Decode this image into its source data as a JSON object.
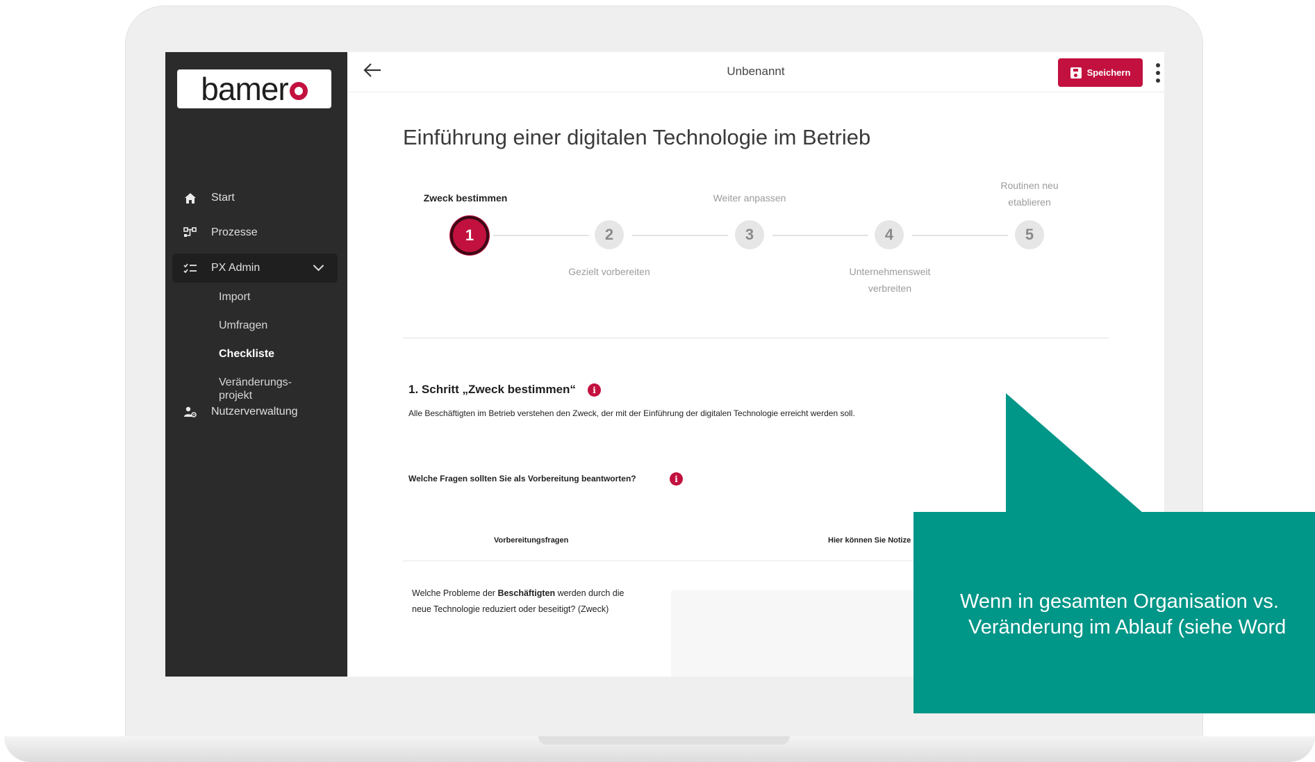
{
  "app": {
    "logo_text": "bamer",
    "document_title": "Unbenannt",
    "save_label": "Speichern"
  },
  "sidebar": {
    "items": [
      {
        "label": "Start",
        "icon": "home-icon"
      },
      {
        "label": "Prozesse",
        "icon": "process-icon"
      },
      {
        "label": "PX Admin",
        "icon": "checklist-icon",
        "expanded": true
      },
      {
        "label": "Nutzerverwaltung",
        "icon": "user-settings-icon"
      }
    ],
    "sub_items": [
      {
        "label": "Import"
      },
      {
        "label": "Umfragen"
      },
      {
        "label": "Checkliste",
        "current": true
      },
      {
        "label": "Veränderungs-",
        "label2": "projekt"
      }
    ]
  },
  "main": {
    "title": "Einführung einer digitalen Technologie im Betrieb",
    "steps": [
      {
        "number": "1",
        "label": "Zweck bestimmen",
        "state": "current"
      },
      {
        "number": "2",
        "label": "Gezielt vorbereiten"
      },
      {
        "number": "3",
        "label": "Weiter anpassen"
      },
      {
        "number": "4",
        "label_line1": "Unternehmensweit",
        "label_line2": "verbreiten"
      },
      {
        "number": "5",
        "label_line1": "Routinen neu",
        "label_line2": "etablieren"
      }
    ],
    "section": {
      "heading": "1. Schritt „Zweck bestimmen“",
      "description": "Alle Beschäftigten im Betrieb verstehen den Zweck, der mit der Einführung der digitalen Technologie erreicht werden soll.",
      "question": "Welche Fragen sollten Sie als Vorbereitung beantworten?",
      "info_glyph": "i"
    },
    "table": {
      "headers": [
        "Vorbereitungsfragen",
        "Hier können Sie Notize"
      ],
      "rows": [
        {
          "question_before": "Welche Probleme der ",
          "question_bold": "Beschäftigten",
          "question_after": " werden durch die",
          "question_line2": "neue Technologie reduziert oder beseitigt? (Zweck)"
        }
      ]
    }
  },
  "callout": {
    "line1": "Wenn in gesamten Organisation vs.",
    "line2": "Veränderung im Ablauf (siehe Word",
    "color": "#009688"
  },
  "colors": {
    "accent": "#c2113f",
    "sidebar_bg": "#2b2b2b"
  }
}
